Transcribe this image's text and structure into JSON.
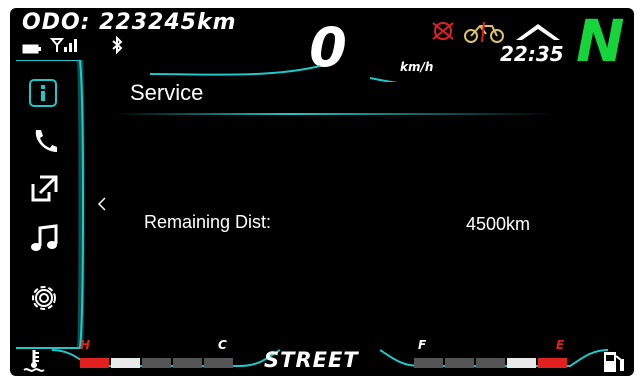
{
  "odometer": "ODO: 223245km",
  "speed": {
    "value": "0",
    "unit": "km/h"
  },
  "clock": "22:35",
  "gear": "N",
  "ride_mode": "STREET",
  "service": {
    "title": "Service",
    "remaining_label": "Remaining Dist:",
    "remaining_value": "4500km"
  },
  "gauges": {
    "temp_hot": "H",
    "temp_cold": "C",
    "fuel_full": "F",
    "fuel_empty": "E"
  },
  "icons": {
    "status": [
      "battery-icon",
      "signal-icon",
      "bluetooth-icon",
      "warning-icon",
      "motorcycle-icon",
      "shift-up-icon"
    ],
    "sidebar": [
      "info-icon",
      "phone-icon",
      "share-icon",
      "music-icon",
      "settings-icon"
    ],
    "bottom": [
      "coolant-temp-icon",
      "fuel-pump-icon"
    ]
  },
  "colors": {
    "accent": "#1fc8c8",
    "gear": "#16d43c",
    "warning": "#e12020"
  }
}
